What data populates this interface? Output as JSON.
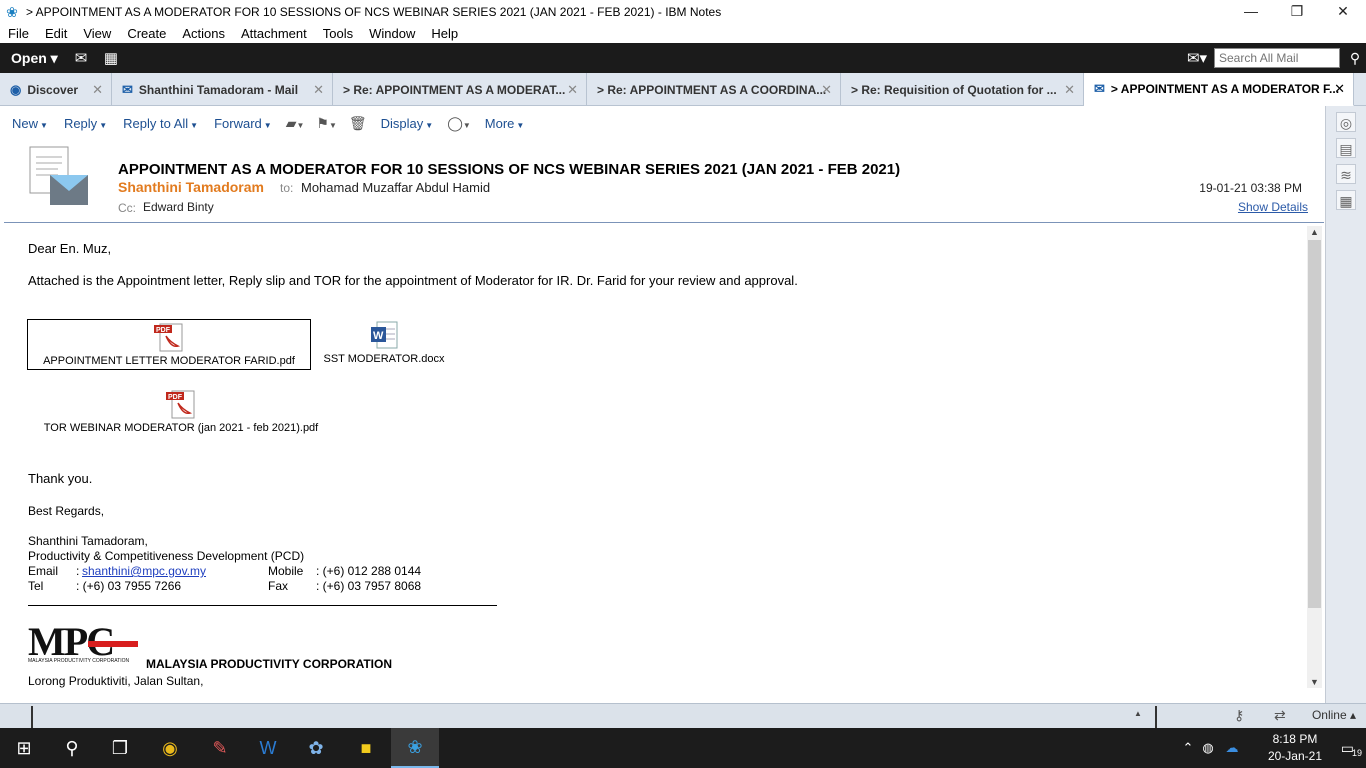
{
  "window": {
    "title": "> APPOINTMENT AS A MODERATOR FOR 10 SESSIONS OF NCS WEBINAR SERIES 2021 (JAN 2021 - FEB 2021) - IBM Notes",
    "minimize": "—",
    "maximize": "❐",
    "close": "✕"
  },
  "menu": [
    "File",
    "Edit",
    "View",
    "Create",
    "Actions",
    "Attachment",
    "Tools",
    "Window",
    "Help"
  ],
  "toolbar": {
    "open_label": "Open ▾",
    "search_placeholder": "Search All Mail"
  },
  "tabs": [
    {
      "label": "Discover",
      "icon": "discover-icon"
    },
    {
      "label": "Shanthini Tamadoram - Mail",
      "icon": "mail-icon"
    },
    {
      "label": "> Re: APPOINTMENT AS A MODERAT...",
      "icon": ""
    },
    {
      "label": "> Re: APPOINTMENT AS A COORDINA...",
      "icon": ""
    },
    {
      "label": "> Re: Requisition of Quotation for ...",
      "icon": ""
    },
    {
      "label": "> APPOINTMENT AS A MODERATOR F...",
      "icon": "mail-icon"
    }
  ],
  "actions": {
    "new": "New",
    "reply": "Reply",
    "reply_all": "Reply to All",
    "forward": "Forward",
    "display": "Display",
    "more": "More"
  },
  "header": {
    "subject": "APPOINTMENT AS A MODERATOR FOR 10 SESSIONS OF NCS WEBINAR SERIES 2021 (JAN 2021 - FEB 2021)",
    "from": "Shanthini Tamadoram",
    "to_label": "to:",
    "to": "Mohamad Muzaffar Abdul Hamid",
    "cc_label": "Cc:",
    "cc": "Edward Binty",
    "date": "19-01-21 03:38 PM",
    "show_details": "Show Details"
  },
  "body": {
    "greeting": "Dear En. Muz,",
    "paragraph": "Attached is the Appointment letter, Reply slip and  TOR for the appointment of Moderator for IR. Dr. Farid  for your review and approval.",
    "attachments": [
      {
        "name": "APPOINTMENT LETTER MODERATOR FARID.pdf",
        "type": "pdf"
      },
      {
        "name": "SST MODERATOR.docx",
        "type": "word"
      },
      {
        "name": "TOR WEBINAR MODERATOR (jan 2021 - feb 2021).pdf",
        "type": "pdf"
      }
    ],
    "thanks": "Thank you.",
    "regards": "Best Regards,",
    "sig_name": "Shanthini Tamadoram,",
    "sig_dept": "Productivity & Competitiveness Development (PCD)",
    "sig_email_label": "Email",
    "sig_email": "shanthini@mpc.gov.my",
    "sig_mobile_label": "Mobile",
    "sig_mobile": ": (+6) 012 288 0144",
    "sig_tel_label": "Tel",
    "sig_tel": ": (+6) 03 7955 7266",
    "sig_fax_label": "Fax",
    "sig_fax": ": (+6) 03 7957 8068",
    "colon": ":",
    "logo_letters": "MPC",
    "logo_small": "MALAYSIA PRODUCTIVITY CORPORATION",
    "org_name": "MALAYSIA PRODUCTIVITY CORPORATION",
    "address": "Lorong Produktiviti, Jalan Sultan,"
  },
  "statusbar": {
    "online": "Online ▴"
  },
  "taskbar": {
    "time": "8:18 PM",
    "date": "20-Jan-21",
    "notifications": "19"
  }
}
